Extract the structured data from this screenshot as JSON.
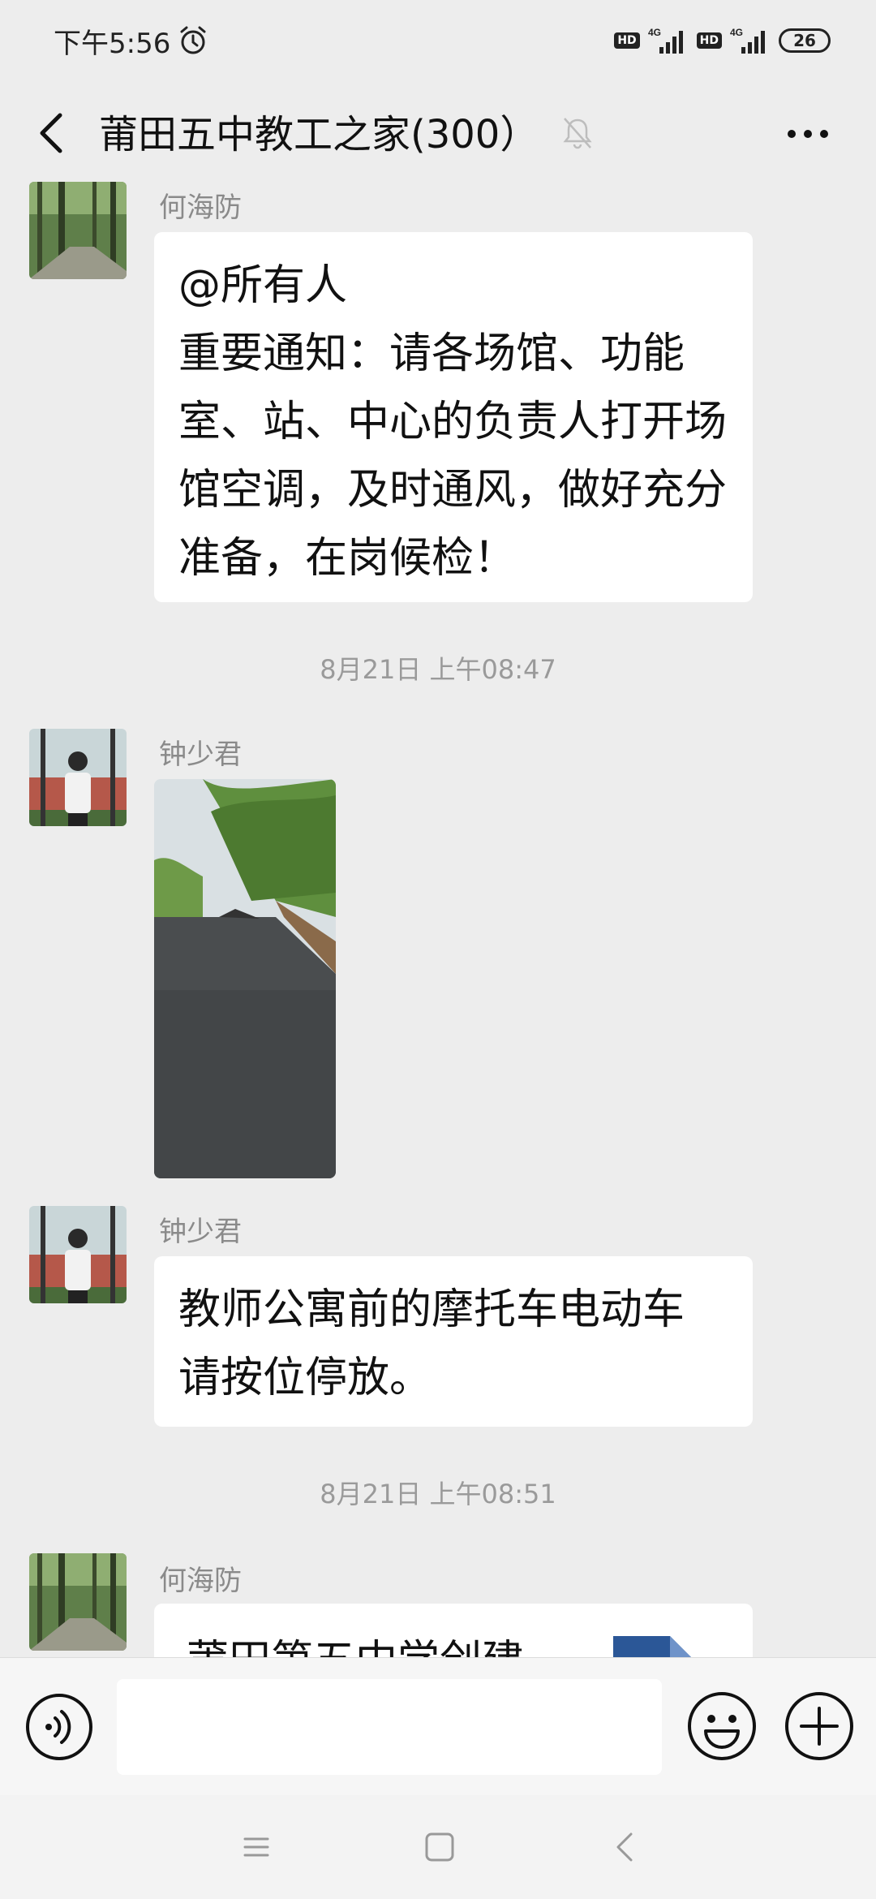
{
  "status_bar": {
    "time": "下午5:56",
    "hd_1": "HD",
    "hd_2": "HD",
    "net_1": "4G",
    "net_2": "4G",
    "battery": "26"
  },
  "header": {
    "title": "莆田五中教工之家(300）"
  },
  "messages": [
    {
      "sender": "何海防",
      "lines": [
        "@所有人",
        "重要通知：请各场馆、功能",
        "室、站、中心的负责人打开场",
        "馆空调，及时通风，做好充分",
        "准备，在岗候检！"
      ]
    },
    {
      "timestamp": "8月21日 上午08:47"
    },
    {
      "sender": "钟少君",
      "image": "photo-road"
    },
    {
      "sender": "钟少君",
      "lines": [
        "教师公寓前的摩托车电动车",
        "请按位停放。"
      ]
    },
    {
      "timestamp": "8月21日 上午08:51"
    },
    {
      "sender": "何海防",
      "file_title": "莆田第五中学创建"
    }
  ],
  "input": {
    "value": "",
    "placeholder": ""
  },
  "colors": {
    "background": "#ededed",
    "bubble": "#ffffff",
    "file_icon": "#2b5797"
  }
}
